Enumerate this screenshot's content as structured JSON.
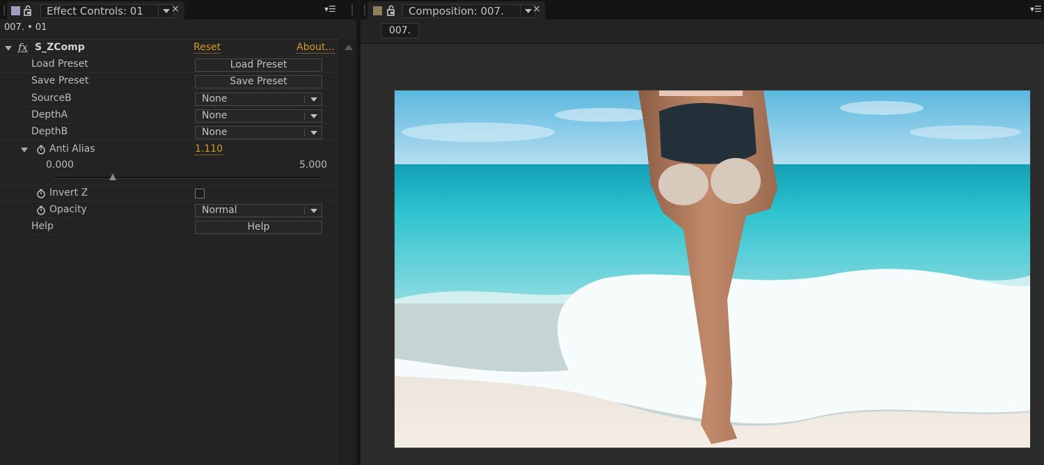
{
  "effect_controls": {
    "tab_title": "Effect Controls: 01",
    "layer_path": "007. • 01",
    "label_color": "#a29bc2",
    "effect": {
      "name": "S_ZComp",
      "reset_label": "Reset",
      "about_label": "About...",
      "load_preset": {
        "label": "Load Preset",
        "button": "Load Preset"
      },
      "save_preset": {
        "label": "Save Preset",
        "button": "Save Preset"
      },
      "source_b": {
        "label": "SourceB",
        "value": "None"
      },
      "depth_a": {
        "label": "DepthA",
        "value": "None"
      },
      "depth_b": {
        "label": "DepthB",
        "value": "None"
      },
      "anti_alias": {
        "label": "Anti Alias",
        "value": "1.110",
        "min": "0.000",
        "max": "5.000",
        "slider_fraction": 0.222
      },
      "invert_z": {
        "label": "Invert Z",
        "checked": false
      },
      "opacity": {
        "label": "Opacity",
        "value": "Normal"
      },
      "help": {
        "label": "Help",
        "button": "Help"
      }
    }
  },
  "composition": {
    "tab_title": "Composition: 007.",
    "label_color": "#8e7f5c",
    "comp_chip": "007.",
    "image_subject": "beach-photo"
  },
  "icons": {
    "close": "×",
    "panel_menu": "▾☰"
  }
}
